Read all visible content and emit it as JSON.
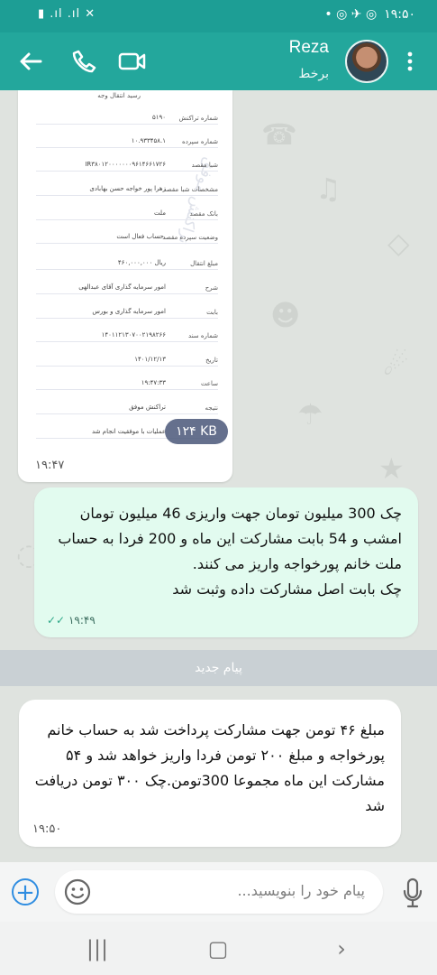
{
  "status_bar": {
    "left_icons": "▮ .ıl .ıl  ✕",
    "right_icons": "•  ◎  ✈  ◎",
    "time": "۱۹:۵۰"
  },
  "header": {
    "contact_name": "Reza",
    "contact_status": "برخط",
    "accent_color": "#23a79c"
  },
  "messages": {
    "receipt": {
      "title": "رسید انتقال وجه",
      "rows": [
        {
          "label": "شماره تراکنش",
          "value": "۵۱۹۰"
        },
        {
          "label": "شماره سپرده",
          "value": "۱۰.۹۳۳۴۵۸.۱"
        },
        {
          "label": "شبا مقصد",
          "value": "IR۳۸۰۱۲۰۰۰۰۰۰۰۹۶۱۴۶۶۱۷۲۶"
        },
        {
          "label": "مشخصات شبا مقصد",
          "value": "زهرا پور خواجه حسن بهابادی"
        },
        {
          "label": "بانک مقصد",
          "value": "ملت"
        },
        {
          "label": "وضعیت سپرده مقصد",
          "value": "حساب فعال است."
        },
        {
          "label": "مبلغ انتقال",
          "value": "۴۶۰,۰۰۰,۰۰۰ ریال"
        },
        {
          "label": "شرح",
          "value": "امور سرمایه گذاری آقای عبدالهی"
        },
        {
          "label": "بابت",
          "value": "امور سرمایه گذاری و بورس"
        },
        {
          "label": "شماره سند",
          "value": "۱۴۰۱۱۲۱۳۰۷۰۰۲۱۹۸۲۶۶"
        },
        {
          "label": "تاریخ",
          "value": "۱۴۰۱/۱۲/۱۳"
        },
        {
          "label": "ساعت",
          "value": "۱۹:۴۷:۳۳"
        },
        {
          "label": "نتیجه",
          "value": "تراکنش موفق"
        },
        {
          "label": "",
          "value": "عملیات با موفقیت انجام شد"
        }
      ],
      "stamp": "تراکنش موفق",
      "file_size": "۱۲۴ KB",
      "time": "۱۹:۴۷"
    },
    "sent": {
      "text": "چک 300 میلیون تومان جهت واریزی 46 میلیون تومان امشب و 54 بابت مشارکت این ماه و 200 فردا به حساب ملت خانم پورخواجه واریز می کنند.\nچک بابت اصل مشارکت داده وثبت شد",
      "time": "۱۹:۴۹",
      "status": "✓✓"
    },
    "new_messages_label": "پیام جدید",
    "received": {
      "text": "مبلغ ۴۶ تومن جهت مشارکت پرداخت شد به حساب خانم پورخواجه و مبلغ ۲۰۰ تومن فردا واریز خواهد شد و ۵۴ مشارکت این ماه مجموعا 300تومن.چک ۳۰۰ تومن دریافت شد",
      "time": "۱۹:۵۰"
    }
  },
  "composer": {
    "placeholder": "پیام خود را بنویسید..."
  },
  "navigation": {
    "recents_glyph": "|||",
    "home_glyph": "▢",
    "back_glyph": "›"
  }
}
